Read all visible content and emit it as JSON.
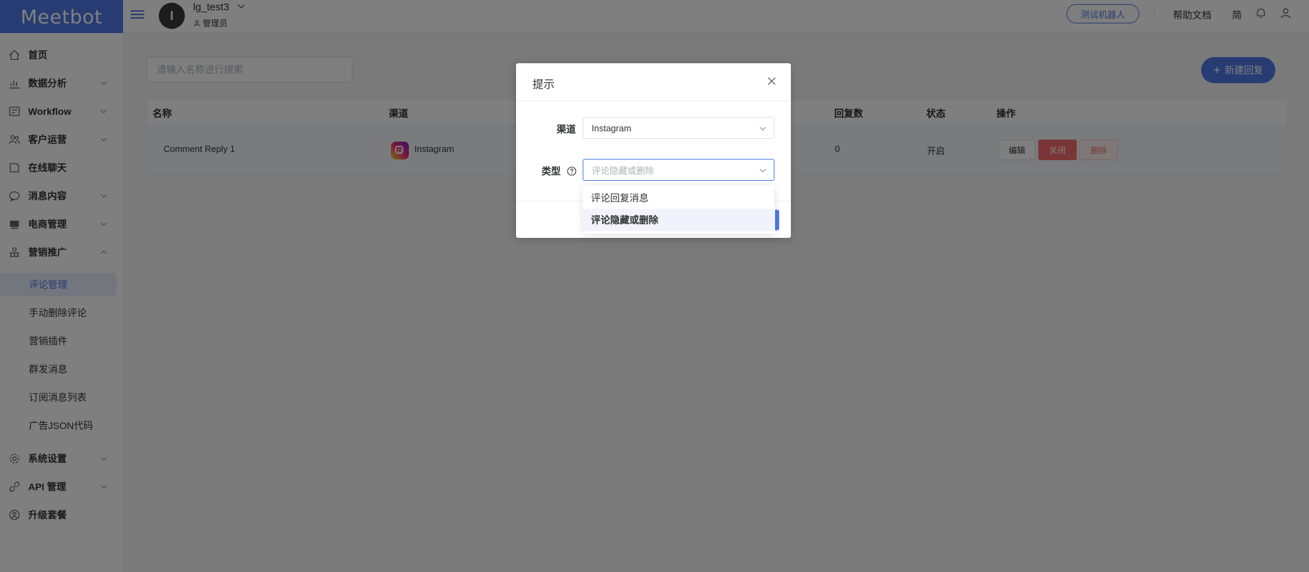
{
  "app": {
    "logo": "Meetbot"
  },
  "header": {
    "username": "lg_test3",
    "avatar_initial": "I",
    "role": "管理员",
    "test_bot": "测试机器人",
    "help_doc": "帮助文档",
    "lang": "简"
  },
  "sidebar": {
    "items": [
      {
        "label": "首页",
        "icon": "home-icon",
        "has_children": false
      },
      {
        "label": "数据分析",
        "icon": "chart-icon",
        "has_children": true
      },
      {
        "label": "Workflow",
        "icon": "workflow-icon",
        "has_children": true
      },
      {
        "label": "客户运营",
        "icon": "users-icon",
        "has_children": true
      },
      {
        "label": "在线聊天",
        "icon": "chat-icon",
        "has_children": false
      },
      {
        "label": "消息内容",
        "icon": "message-icon",
        "has_children": true
      },
      {
        "label": "电商管理",
        "icon": "shop-icon",
        "has_children": true
      },
      {
        "label": "营销推广",
        "icon": "marketing-icon",
        "has_children": true,
        "expanded": true
      }
    ],
    "sub_items": [
      {
        "label": "评论管理",
        "active": true
      },
      {
        "label": "手动删除评论",
        "active": false
      },
      {
        "label": "营销插件",
        "active": false
      },
      {
        "label": "群发消息",
        "active": false
      },
      {
        "label": "订阅消息列表",
        "active": false
      },
      {
        "label": "广告JSON代码",
        "active": false
      }
    ],
    "bottom_items": [
      {
        "label": "系统设置",
        "icon": "settings-icon",
        "has_children": true
      },
      {
        "label": "API 管理",
        "icon": "api-icon",
        "has_children": true
      },
      {
        "label": "升级套餐",
        "icon": "upgrade-icon",
        "has_children": false
      }
    ]
  },
  "main": {
    "search_placeholder": "请输入名称进行搜索",
    "new_reply_label": "新建回复",
    "table": {
      "headers": [
        "名称",
        "渠道",
        "回复数",
        "状态",
        "操作"
      ],
      "rows": [
        {
          "name": "Comment Reply 1",
          "channel": "Instagram",
          "reply_count": "0",
          "status": "开启",
          "actions": [
            "编辑",
            "关闭",
            "删除"
          ]
        }
      ]
    }
  },
  "dialog": {
    "title": "提示",
    "channel_label": "渠道",
    "channel_value": "Instagram",
    "type_label": "类型",
    "type_placeholder": "评论隐藏或删除",
    "options": [
      "评论回复消息",
      "评论隐藏或删除"
    ],
    "selected_option": "评论隐藏或删除"
  },
  "colors": {
    "accent": "#4f79e6",
    "danger": "#f56c6c"
  }
}
